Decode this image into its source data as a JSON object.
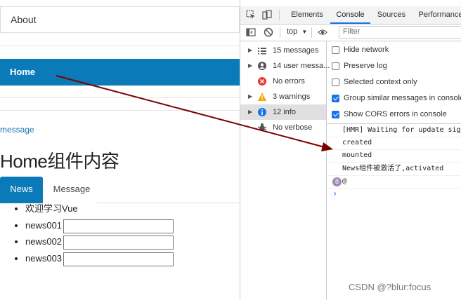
{
  "app": {
    "nav": {
      "about": "About",
      "home": "Home"
    },
    "message_link": "message",
    "home_title": "Home组件内容",
    "tabs": [
      {
        "label": "News",
        "active": true
      },
      {
        "label": "Message",
        "active": false
      }
    ],
    "news_items": [
      {
        "label": "欢迎学习Vue",
        "has_input": false
      },
      {
        "label": "news001",
        "has_input": true,
        "value": ""
      },
      {
        "label": "news002",
        "has_input": true,
        "value": ""
      },
      {
        "label": "news003",
        "has_input": true,
        "value": ""
      }
    ]
  },
  "devtools": {
    "tabs": [
      "Elements",
      "Console",
      "Sources",
      "Performance"
    ],
    "active_tab": "Console",
    "toolbar": {
      "context": "top",
      "filter_placeholder": "Filter"
    },
    "sidebar": [
      {
        "label": "15 messages",
        "icon": "list-icon",
        "selected": false
      },
      {
        "label": "14 user messa...",
        "icon": "user-icon",
        "selected": false
      },
      {
        "label": "No errors",
        "icon": "error-icon",
        "selected": false
      },
      {
        "label": "3 warnings",
        "icon": "warning-icon",
        "selected": false
      },
      {
        "label": "12 info",
        "icon": "info-icon",
        "selected": true
      },
      {
        "label": "No verbose",
        "icon": "bug-icon",
        "selected": false
      }
    ],
    "settings": [
      {
        "label": "Hide network",
        "checked": false
      },
      {
        "label": "Preserve log",
        "checked": false
      },
      {
        "label": "Selected context only",
        "checked": false
      },
      {
        "label": "Group similar messages in console",
        "checked": true
      },
      {
        "label": "Show CORS errors in console",
        "checked": true
      }
    ],
    "console_lines": [
      "[HMR] Waiting for update signal",
      "created",
      "mounted",
      "News组件被激活了,activated",
      "@"
    ],
    "repeat_badge": "8",
    "prompt_symbol": "›"
  },
  "watermark": "CSDN @?blur:focus",
  "colors": {
    "accent": "#0a7bb8",
    "devtools_blue": "#1a73e8",
    "arrow": "#7a0000"
  }
}
